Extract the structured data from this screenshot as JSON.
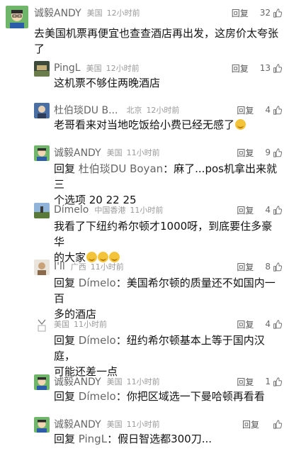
{
  "comments": [
    {
      "author": "诚毅ANDY",
      "region": "美国",
      "time": "12小时前",
      "reply_label": "回复",
      "likes": "32",
      "text_lines": [
        "去美国机票再便宜也查查酒店再出发，这房价太夸张",
        "了"
      ]
    },
    {
      "author": "PingL",
      "region": "美国",
      "time": "12小时前",
      "reply_label": "回复",
      "likes": "13",
      "text_lines": [
        "这机票不够住两晚酒店"
      ]
    },
    {
      "author": "杜伯琰DU B...",
      "region": "北京",
      "time": "12小时前",
      "reply_label": "回复",
      "likes": "4",
      "text_lines": [
        "老哥看来对当地吃饭给小费已经无感了"
      ]
    },
    {
      "author": "诚毅ANDY",
      "region": "美国",
      "time": "11小时前",
      "reply_label": "回复",
      "likes": "9",
      "reply_prefix": "回复",
      "reply_target": "杜伯琰DU Boyan",
      "text_lines": [
        "：麻了...pos机拿出来就三",
        "个选项 20 22 25"
      ]
    },
    {
      "author": "Dímelo",
      "region": "中国香港",
      "time": "11小时前",
      "reply_label": "回复",
      "likes": "4",
      "text_lines": [
        "我看了下纽约希尔顿才1000呀，到底要住多豪华",
        "的大家"
      ]
    },
    {
      "author": "I'll",
      "region": "广西",
      "time": "11小时前",
      "reply_label": "回复",
      "likes": "8",
      "reply_prefix": "回复",
      "reply_target": "Dímelo",
      "text_lines": [
        "：美国希尔顿的质量还不如国内一百",
        "多的酒店"
      ]
    },
    {
      "author": "",
      "region": "美国",
      "time": "11小时前",
      "reply_label": "回复",
      "likes": "4",
      "reply_prefix": "回复",
      "reply_target": "Dímelo",
      "text_lines": [
        "：纽约希尔顿基本上等于国内汉庭，",
        "可能还差一点"
      ]
    },
    {
      "author": "诚毅ANDY",
      "region": "美国",
      "time": "11小时前",
      "reply_label": "回复",
      "likes": "1",
      "reply_prefix": "回复",
      "reply_target": "Dímelo",
      "text_lines": [
        "：你把区域选一下曼哈顿再看看"
      ]
    },
    {
      "author": "诚毅ANDY",
      "region": "美国",
      "time": "11小时前",
      "reply_label": "回复",
      "likes": "",
      "reply_prefix": "回复",
      "reply_target": "PingL",
      "text_lines": [
        "：假日智选都300刀..."
      ]
    }
  ],
  "icons": {
    "like": "thumbs-up-icon",
    "emoji": "grinning-sweat-emoji"
  },
  "colors": {
    "meta_gray": "#9a9a9a",
    "author_gray": "#666666",
    "text": "#111111"
  }
}
